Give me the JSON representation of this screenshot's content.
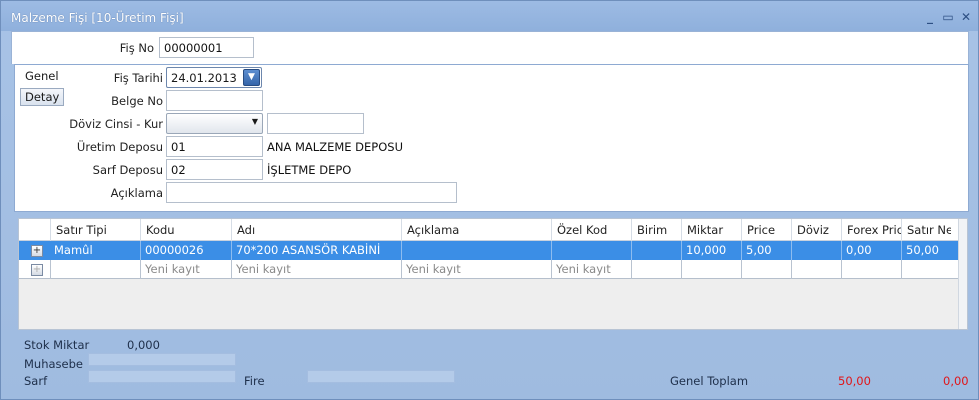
{
  "window": {
    "title": "Malzeme Fişi  [10-Üretim Fişi]",
    "controls": [
      "minimize",
      "maximize",
      "close"
    ]
  },
  "form": {
    "fis_no_label": "Fiş No",
    "fis_no_value": "00000001",
    "tabs": [
      "Genel",
      "Detay"
    ],
    "fis_tarihi_label": "Fiş Tarihi",
    "fis_tarihi_value": "24.01.2013",
    "belge_no_label": "Belge No",
    "belge_no_value": "",
    "doviz_label": "Döviz Cinsi - Kur",
    "doviz_value": "",
    "kur_value": "",
    "uretim_deposu_label": "Üretim Deposu",
    "uretim_deposu_code": "01",
    "uretim_deposu_name": "ANA MALZEME DEPOSU",
    "sarf_deposu_label": "Sarf Deposu",
    "sarf_deposu_code": "02",
    "sarf_deposu_name": "İŞLETME DEPO",
    "aciklama_label": "Açıklama",
    "aciklama_value": ""
  },
  "grid": {
    "columns": [
      "Satır Tipi",
      "Kodu",
      "Adı",
      "Açıklama",
      "Özel Kod",
      "Birim",
      "Miktar",
      "Price",
      "Döviz",
      "Forex Pric",
      "Satır Ne"
    ],
    "rows": [
      {
        "expander": "+",
        "satir_tipi": "Mamûl",
        "kodu": "00000026",
        "adi": "70*200 ASANSÖR KABİNİ",
        "aciklama": "",
        "ozel_kod": "",
        "birim": "",
        "miktar": "10,000",
        "price": "5,00",
        "doviz": "",
        "forex": "0,00",
        "satir_net": "50,00"
      }
    ],
    "new_row": {
      "expander": "+",
      "kodu": "Yeni kayıt",
      "adi": "Yeni kayıt",
      "aciklama": "Yeni kayıt",
      "ozel_kod": "Yeni kayıt"
    }
  },
  "footer": {
    "stok_miktar_label": "Stok Miktar",
    "stok_miktar_value": "0,000",
    "muhasebe_label": "Muhasebe",
    "sarf_label": "Sarf",
    "fire_label": "Fire",
    "genel_toplam_label": "Genel Toplam",
    "genel_toplam_value": "50,00",
    "extra_value": "0,00"
  },
  "colors": {
    "selected_row": "#3b8ee6",
    "total_red": "#e0161a",
    "window_bg": "#a9c4e6"
  }
}
